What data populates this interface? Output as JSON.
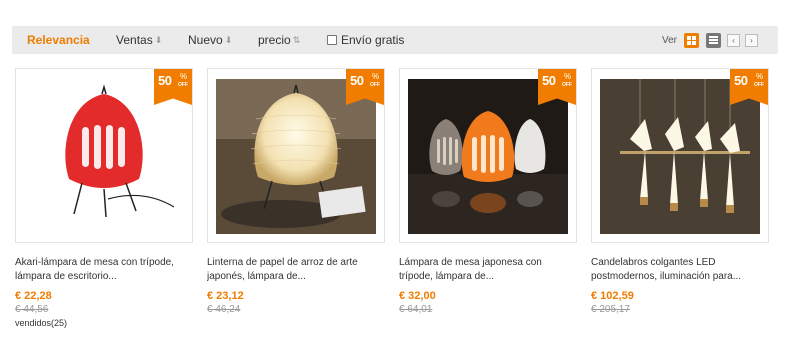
{
  "sortbar": {
    "relevance": "Relevancia",
    "ventas": "Ventas",
    "nuevo": "Nuevo",
    "precio": "precio",
    "envio": "Envío gratis",
    "ver": "Ver",
    "arrow_down": "⬇",
    "arrow_updown": "⇅",
    "prev": "‹",
    "next": "›"
  },
  "colors": {
    "accent": "#f07c00",
    "bar_bg": "#ebebeb",
    "old_price": "#999999"
  },
  "badge": {
    "percent": "50",
    "symbol": "%",
    "label": "OFF"
  },
  "products": [
    {
      "title": "Akari-lámpara de mesa con trípode, lámpara de escritorio...",
      "price": "€ 22,28",
      "old_price": "€ 44,56",
      "sold": "vendidos(25)",
      "icon": "red-paper-lamp-image"
    },
    {
      "title": "Linterna de papel de arroz de arte japonés, lámpara de...",
      "price": "€ 23,12",
      "old_price": "€ 46,24",
      "sold": "",
      "icon": "rice-paper-lantern-image"
    },
    {
      "title": "Lámpara de mesa japonesa con trípode, lámpara de...",
      "price": "€ 32,00",
      "old_price": "€ 64,01",
      "sold": "",
      "icon": "japanese-table-lamps-image"
    },
    {
      "title": "Candelabros colgantes LED postmodernos, iluminación para...",
      "price": "€ 102,59",
      "old_price": "€ 205,17",
      "sold": "",
      "icon": "bird-chandelier-image"
    }
  ]
}
